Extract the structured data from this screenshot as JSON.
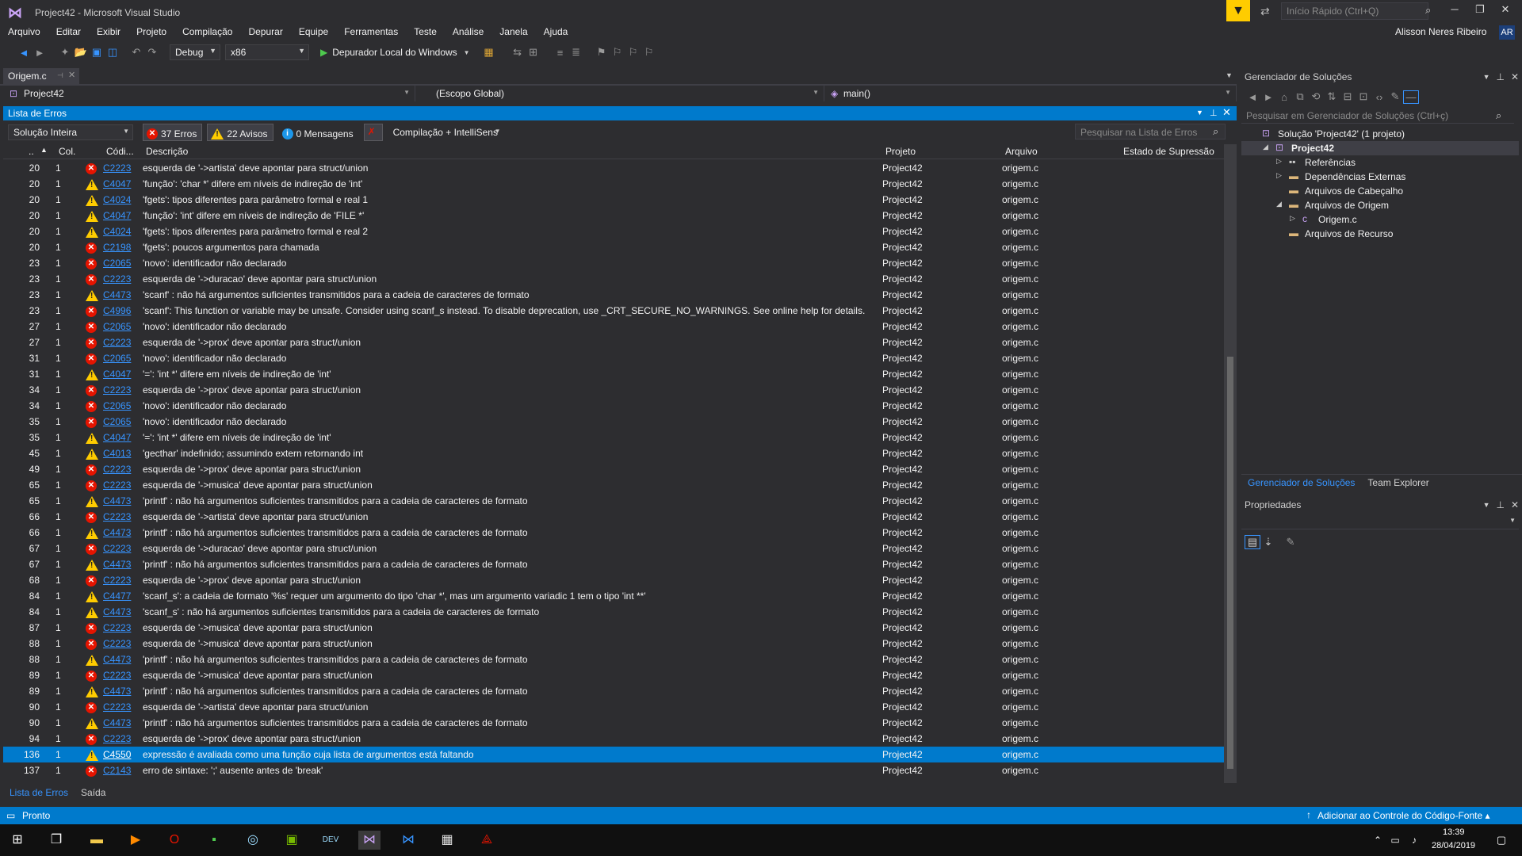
{
  "window": {
    "title": "Project42 - Microsoft Visual Studio",
    "quick_launch_placeholder": "Início Rápido (Ctrl+Q)"
  },
  "menu": [
    "Arquivo",
    "Editar",
    "Exibir",
    "Projeto",
    "Compilação",
    "Depurar",
    "Equipe",
    "Ferramentas",
    "Teste",
    "Análise",
    "Janela",
    "Ajuda"
  ],
  "user": {
    "name": "Alisson Neres Ribeiro",
    "initials": "AR"
  },
  "toolbar": {
    "config": "Debug",
    "platform": "x86",
    "debugger": "Depurador Local do Windows"
  },
  "editor": {
    "tab": "Origem.c",
    "project_combo": "Project42",
    "scope_combo": "(Escopo Global)",
    "function_combo": "main()"
  },
  "error_list": {
    "title": "Lista de Erros",
    "scope": "Solução Inteira",
    "errors_label": "37 Erros",
    "warnings_label": "22 Avisos",
    "messages_label": "0 Mensagens",
    "build_filter": "Compilação + IntelliSens",
    "search_placeholder": "Pesquisar na Lista de Erros",
    "headers": {
      "line": "..",
      "col": "Col.",
      "code": "Códi...",
      "desc": "Descrição",
      "project": "Projeto",
      "file": "Arquivo",
      "suppression": "Estado de Supressão"
    },
    "rows": [
      {
        "line": "20",
        "col": "1",
        "type": "error",
        "code": "C2223",
        "desc": "esquerda de '->artista' deve apontar para struct/union",
        "project": "Project42",
        "file": "origem.c"
      },
      {
        "line": "20",
        "col": "1",
        "type": "warning",
        "code": "C4047",
        "desc": "'função': 'char *' difere em níveis de indireção de 'int'",
        "project": "Project42",
        "file": "origem.c"
      },
      {
        "line": "20",
        "col": "1",
        "type": "warning",
        "code": "C4024",
        "desc": "'fgets': tipos diferentes para parâmetro formal e real 1",
        "project": "Project42",
        "file": "origem.c"
      },
      {
        "line": "20",
        "col": "1",
        "type": "warning",
        "code": "C4047",
        "desc": "'função': 'int' difere em níveis de indireção de 'FILE *'",
        "project": "Project42",
        "file": "origem.c"
      },
      {
        "line": "20",
        "col": "1",
        "type": "warning",
        "code": "C4024",
        "desc": "'fgets': tipos diferentes para parâmetro formal e real 2",
        "project": "Project42",
        "file": "origem.c"
      },
      {
        "line": "20",
        "col": "1",
        "type": "error",
        "code": "C2198",
        "desc": "'fgets': poucos argumentos para chamada",
        "project": "Project42",
        "file": "origem.c"
      },
      {
        "line": "23",
        "col": "1",
        "type": "error",
        "code": "C2065",
        "desc": "'novo': identificador não declarado",
        "project": "Project42",
        "file": "origem.c"
      },
      {
        "line": "23",
        "col": "1",
        "type": "error",
        "code": "C2223",
        "desc": "esquerda de '->duracao' deve apontar para struct/union",
        "project": "Project42",
        "file": "origem.c"
      },
      {
        "line": "23",
        "col": "1",
        "type": "warning",
        "code": "C4473",
        "desc": "'scanf' : não há argumentos suficientes transmitidos para a cadeia de caracteres de formato",
        "project": "Project42",
        "file": "origem.c"
      },
      {
        "line": "23",
        "col": "1",
        "type": "error",
        "code": "C4996",
        "desc": "'scanf': This function or variable may be unsafe. Consider using scanf_s instead. To disable deprecation, use _CRT_SECURE_NO_WARNINGS. See online help for details.",
        "project": "Project42",
        "file": "origem.c"
      },
      {
        "line": "27",
        "col": "1",
        "type": "error",
        "code": "C2065",
        "desc": "'novo': identificador não declarado",
        "project": "Project42",
        "file": "origem.c"
      },
      {
        "line": "27",
        "col": "1",
        "type": "error",
        "code": "C2223",
        "desc": "esquerda de '->prox' deve apontar para struct/union",
        "project": "Project42",
        "file": "origem.c"
      },
      {
        "line": "31",
        "col": "1",
        "type": "error",
        "code": "C2065",
        "desc": "'novo': identificador não declarado",
        "project": "Project42",
        "file": "origem.c"
      },
      {
        "line": "31",
        "col": "1",
        "type": "warning",
        "code": "C4047",
        "desc": "'=': 'int *' difere em níveis de indireção de 'int'",
        "project": "Project42",
        "file": "origem.c"
      },
      {
        "line": "34",
        "col": "1",
        "type": "error",
        "code": "C2223",
        "desc": "esquerda de '->prox' deve apontar para struct/union",
        "project": "Project42",
        "file": "origem.c"
      },
      {
        "line": "34",
        "col": "1",
        "type": "error",
        "code": "C2065",
        "desc": "'novo': identificador não declarado",
        "project": "Project42",
        "file": "origem.c"
      },
      {
        "line": "35",
        "col": "1",
        "type": "error",
        "code": "C2065",
        "desc": "'novo': identificador não declarado",
        "project": "Project42",
        "file": "origem.c"
      },
      {
        "line": "35",
        "col": "1",
        "type": "warning",
        "code": "C4047",
        "desc": "'=': 'int *' difere em níveis de indireção de 'int'",
        "project": "Project42",
        "file": "origem.c"
      },
      {
        "line": "45",
        "col": "1",
        "type": "warning",
        "code": "C4013",
        "desc": "'gecthar' indefinido; assumindo extern retornando int",
        "project": "Project42",
        "file": "origem.c"
      },
      {
        "line": "49",
        "col": "1",
        "type": "error",
        "code": "C2223",
        "desc": "esquerda de '->prox' deve apontar para struct/union",
        "project": "Project42",
        "file": "origem.c"
      },
      {
        "line": "65",
        "col": "1",
        "type": "error",
        "code": "C2223",
        "desc": "esquerda de '->musica' deve apontar para struct/union",
        "project": "Project42",
        "file": "origem.c"
      },
      {
        "line": "65",
        "col": "1",
        "type": "warning",
        "code": "C4473",
        "desc": "'printf' : não há argumentos suficientes transmitidos para a cadeia de caracteres de formato",
        "project": "Project42",
        "file": "origem.c"
      },
      {
        "line": "66",
        "col": "1",
        "type": "error",
        "code": "C2223",
        "desc": "esquerda de '->artista' deve apontar para struct/union",
        "project": "Project42",
        "file": "origem.c"
      },
      {
        "line": "66",
        "col": "1",
        "type": "warning",
        "code": "C4473",
        "desc": "'printf' : não há argumentos suficientes transmitidos para a cadeia de caracteres de formato",
        "project": "Project42",
        "file": "origem.c"
      },
      {
        "line": "67",
        "col": "1",
        "type": "error",
        "code": "C2223",
        "desc": "esquerda de '->duracao' deve apontar para struct/union",
        "project": "Project42",
        "file": "origem.c"
      },
      {
        "line": "67",
        "col": "1",
        "type": "warning",
        "code": "C4473",
        "desc": "'printf' : não há argumentos suficientes transmitidos para a cadeia de caracteres de formato",
        "project": "Project42",
        "file": "origem.c"
      },
      {
        "line": "68",
        "col": "1",
        "type": "error",
        "code": "C2223",
        "desc": "esquerda de '->prox' deve apontar para struct/union",
        "project": "Project42",
        "file": "origem.c"
      },
      {
        "line": "84",
        "col": "1",
        "type": "warning",
        "code": "C4477",
        "desc": "'scanf_s': a cadeia de formato '%s' requer um argumento do tipo 'char *', mas um argumento variadic 1 tem o tipo 'int **'",
        "project": "Project42",
        "file": "origem.c"
      },
      {
        "line": "84",
        "col": "1",
        "type": "warning",
        "code": "C4473",
        "desc": "'scanf_s' : não há argumentos suficientes transmitidos para a cadeia de caracteres de formato",
        "project": "Project42",
        "file": "origem.c"
      },
      {
        "line": "87",
        "col": "1",
        "type": "error",
        "code": "C2223",
        "desc": "esquerda de '->musica' deve apontar para struct/union",
        "project": "Project42",
        "file": "origem.c"
      },
      {
        "line": "88",
        "col": "1",
        "type": "error",
        "code": "C2223",
        "desc": "esquerda de '->musica' deve apontar para struct/union",
        "project": "Project42",
        "file": "origem.c"
      },
      {
        "line": "88",
        "col": "1",
        "type": "warning",
        "code": "C4473",
        "desc": "'printf' : não há argumentos suficientes transmitidos para a cadeia de caracteres de formato",
        "project": "Project42",
        "file": "origem.c"
      },
      {
        "line": "89",
        "col": "1",
        "type": "error",
        "code": "C2223",
        "desc": "esquerda de '->musica' deve apontar para struct/union",
        "project": "Project42",
        "file": "origem.c"
      },
      {
        "line": "89",
        "col": "1",
        "type": "warning",
        "code": "C4473",
        "desc": "'printf' : não há argumentos suficientes transmitidos para a cadeia de caracteres de formato",
        "project": "Project42",
        "file": "origem.c"
      },
      {
        "line": "90",
        "col": "1",
        "type": "error",
        "code": "C2223",
        "desc": "esquerda de '->artista' deve apontar para struct/union",
        "project": "Project42",
        "file": "origem.c"
      },
      {
        "line": "90",
        "col": "1",
        "type": "warning",
        "code": "C4473",
        "desc": "'printf' : não há argumentos suficientes transmitidos para a cadeia de caracteres de formato",
        "project": "Project42",
        "file": "origem.c"
      },
      {
        "line": "94",
        "col": "1",
        "type": "error",
        "code": "C2223",
        "desc": "esquerda de '->prox' deve apontar para struct/union",
        "project": "Project42",
        "file": "origem.c"
      },
      {
        "line": "136",
        "col": "1",
        "type": "warning",
        "code": "C4550",
        "desc": "expressão é avaliada como uma função cuja lista de argumentos está faltando",
        "project": "Project42",
        "file": "origem.c",
        "selected": true
      },
      {
        "line": "137",
        "col": "1",
        "type": "error",
        "code": "C2143",
        "desc": "erro de sintaxe: ';' ausente antes de 'break'",
        "project": "Project42",
        "file": "origem.c"
      }
    ]
  },
  "bottom_tabs": [
    "Lista de Erros",
    "Saída"
  ],
  "solution_explorer": {
    "title": "Gerenciador de Soluções",
    "search_placeholder": "Pesquisar em Gerenciador de Soluções (Ctrl+ç)",
    "tree": [
      {
        "label": "Solução 'Project42' (1 projeto)",
        "indent": 0,
        "exp": "",
        "icon": "solution-icon"
      },
      {
        "label": "Project42",
        "indent": 1,
        "exp": "◢",
        "icon": "project-icon",
        "selected": true,
        "bold": true
      },
      {
        "label": "Referências",
        "indent": 2,
        "exp": "▷",
        "icon": "references-icon"
      },
      {
        "label": "Dependências Externas",
        "indent": 2,
        "exp": "▷",
        "icon": "folder-icon"
      },
      {
        "label": "Arquivos de Cabeçalho",
        "indent": 2,
        "exp": "",
        "icon": "folder-icon"
      },
      {
        "label": "Arquivos de Origem",
        "indent": 2,
        "exp": "◢",
        "icon": "folder-icon"
      },
      {
        "label": "Origem.c",
        "indent": 3,
        "exp": "▷",
        "icon": "c-file-icon"
      },
      {
        "label": "Arquivos de Recurso",
        "indent": 2,
        "exp": "",
        "icon": "folder-icon"
      }
    ],
    "tabs": [
      "Gerenciador de Soluções",
      "Team Explorer"
    ]
  },
  "properties": {
    "title": "Propriedades"
  },
  "status": {
    "text": "Pronto",
    "source_control": "Adicionar ao Controle do Código-Fonte"
  },
  "taskbar": {
    "time": "13:39",
    "date": "28/04/2019"
  }
}
